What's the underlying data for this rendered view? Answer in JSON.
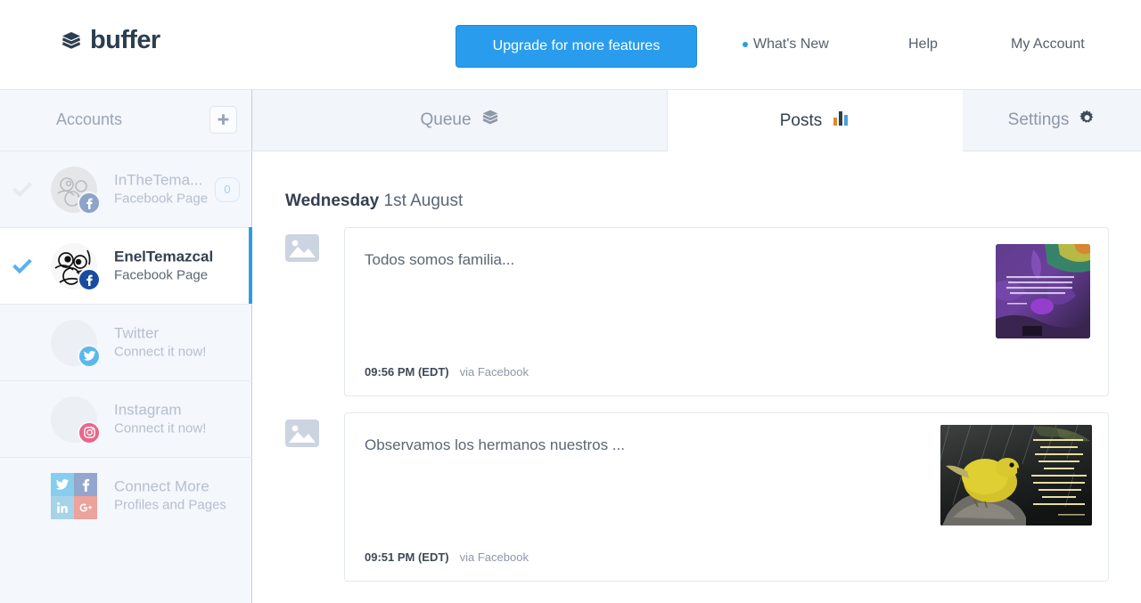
{
  "header": {
    "brand": "buffer",
    "logo_icon": "buffer-layers-icon",
    "upgrade_label": "Upgrade for more features",
    "upgrade_color": "#2a9ced",
    "nav": [
      {
        "label": "What's New",
        "icon": "blue-dot-icon"
      },
      {
        "label": "Help",
        "icon": ""
      },
      {
        "label": "My Account",
        "icon": ""
      }
    ]
  },
  "sidebar": {
    "title": "Accounts",
    "add_icon": "plus-icon",
    "accounts": [
      {
        "name": "InTheTema...",
        "type": "Facebook Page",
        "network": "facebook",
        "selected": false,
        "checkmark_color": "#e7ebf1",
        "count": "0",
        "avatar_kind": "mayan-glyph"
      },
      {
        "name": "EnelTemazcal",
        "type": "Facebook Page",
        "network": "facebook",
        "selected": true,
        "checkmark_color": "#59b0f5",
        "count": "",
        "avatar_kind": "mayan-glyph"
      },
      {
        "name": "Twitter",
        "type": "Connect it now!",
        "network": "twitter",
        "selected": false,
        "checkmark_color": "",
        "count": "",
        "avatar_kind": "empty"
      },
      {
        "name": "Instagram",
        "type": "Connect it now!",
        "network": "instagram",
        "selected": false,
        "checkmark_color": "",
        "count": "",
        "avatar_kind": "empty"
      }
    ],
    "connect_more": {
      "name": "Connect More",
      "type": "Profiles and Pages",
      "tiles": [
        "twitter-icon",
        "facebook-icon",
        "linkedin-icon",
        "googleplus-icon"
      ]
    }
  },
  "tabs": [
    {
      "label": "Queue",
      "icon": "stacked-layers-icon",
      "active": false
    },
    {
      "label": "Posts",
      "icon": "bar-chart-icon",
      "active": true
    },
    {
      "label": "Settings",
      "icon": "gear-icon",
      "active": false
    }
  ],
  "main": {
    "day_weekday": "Wednesday",
    "day_date": "1st August",
    "posts": [
      {
        "text": "Todos somos familia...",
        "time": "09:56 PM (EDT)",
        "via": "via Facebook",
        "media_icon": "photo-icon",
        "thumb_alt": "colorful abstract rainbow artwork with spanish quote"
      },
      {
        "text": "Observamos los hermanos nuestros ...",
        "time": "09:51 PM (EDT)",
        "via": "via Facebook",
        "media_icon": "photo-icon",
        "thumb_alt": "yellow bird on rock in rain with spanish quote"
      }
    ]
  }
}
